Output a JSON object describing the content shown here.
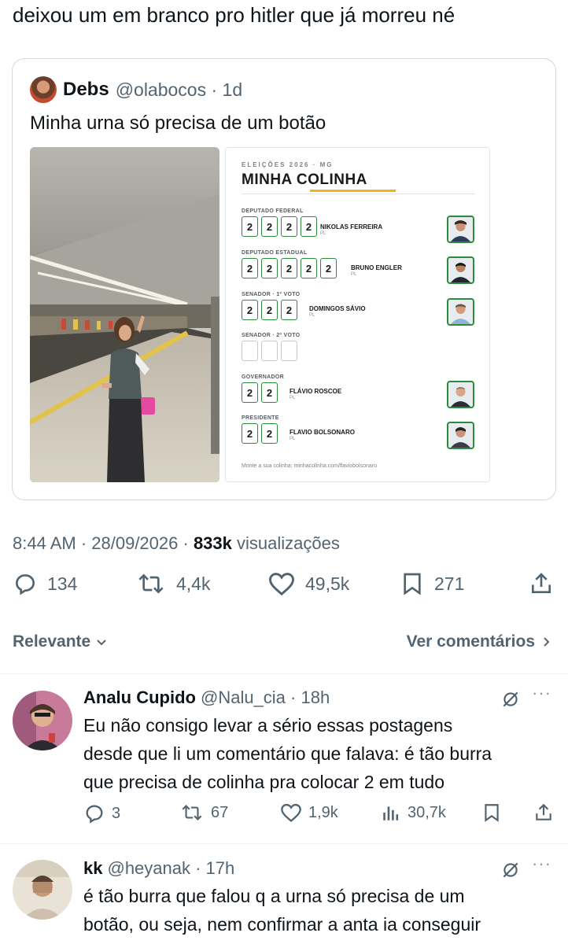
{
  "tweet": {
    "text": "deixou um em branco pro hitler que já morreu né"
  },
  "quote": {
    "name": "Debs",
    "handle_time": "@olabocos · 1d",
    "text": "Minha urna só precisa de um botão",
    "card": {
      "eyebrow": "ELEIÇÕES 2026 · MG",
      "title": "MINHA COLINHA",
      "footer": "Monte a sua colinha: minhacolinha.com/flaviobolsonaro",
      "sections": [
        {
          "label": "DEPUTADO FEDERAL",
          "digits": [
            "2",
            "2",
            "2",
            "2"
          ],
          "candidate": "NIKOLAS FERREIRA",
          "party": "PL"
        },
        {
          "label": "DEPUTADO ESTADUAL",
          "digits": [
            "2",
            "2",
            "2",
            "2",
            "2"
          ],
          "candidate": "BRUNO ENGLER",
          "party": "PL"
        },
        {
          "label": "SENADOR · 1º VOTO",
          "digits": [
            "2",
            "2",
            "2"
          ],
          "candidate": "DOMINGOS SÁVIO",
          "party": "PL"
        },
        {
          "label": "SENADOR · 2º VOTO",
          "digits": [
            "",
            "",
            ""
          ],
          "candidate": "",
          "party": ""
        },
        {
          "label": "GOVERNADOR",
          "digits": [
            "2",
            "2"
          ],
          "candidate": "FLÁVIO ROSCOE",
          "party": "PL"
        },
        {
          "label": "PRESIDENTE",
          "digits": [
            "2",
            "2"
          ],
          "candidate": "FLAVIO BOLSONARO",
          "party": "PL"
        }
      ]
    }
  },
  "meta": {
    "time_date": "8:44 AM · 28/09/2026 · ",
    "views_count": "833k",
    "views_label": " visualizações"
  },
  "actions": {
    "replies": "134",
    "reposts": "4,4k",
    "likes": "49,5k",
    "bookmarks": "271"
  },
  "sort": {
    "left": "Relevante",
    "right": "Ver comentários"
  },
  "replies": [
    {
      "name": "Analu Cupido",
      "meta": "@Nalu_cia · 18h",
      "lines": [
        "Eu não consigo levar a sério essas postagens",
        "desde que li um comentário que falava: é tão burra",
        "que precisa de colinha pra colocar 2 em tudo"
      ],
      "replies": "3",
      "reposts": "67",
      "likes": "1,9k",
      "views": "30,7k"
    },
    {
      "name": "kk",
      "meta": "@heyanak · 17h",
      "lines": [
        "é tão burra que falou q a urna só precisa de um",
        "botão, ou seja, nem confirmar a anta ia conseguir"
      ]
    }
  ],
  "icons": {
    "reply": "speech-bubble-icon",
    "repost": "repost-arrows-icon",
    "like": "heart-icon",
    "bookmark": "bookmark-icon",
    "share": "share-icon",
    "views": "bar-chart-icon",
    "grok": "grok-slash-icon",
    "more": "more-dots-icon"
  },
  "colors": {
    "text": "#0f1419",
    "secondary": "#536471",
    "border": "#cfd9de",
    "accent_green": "#2c8c3c",
    "accent_yellow": "#f2b21b"
  }
}
